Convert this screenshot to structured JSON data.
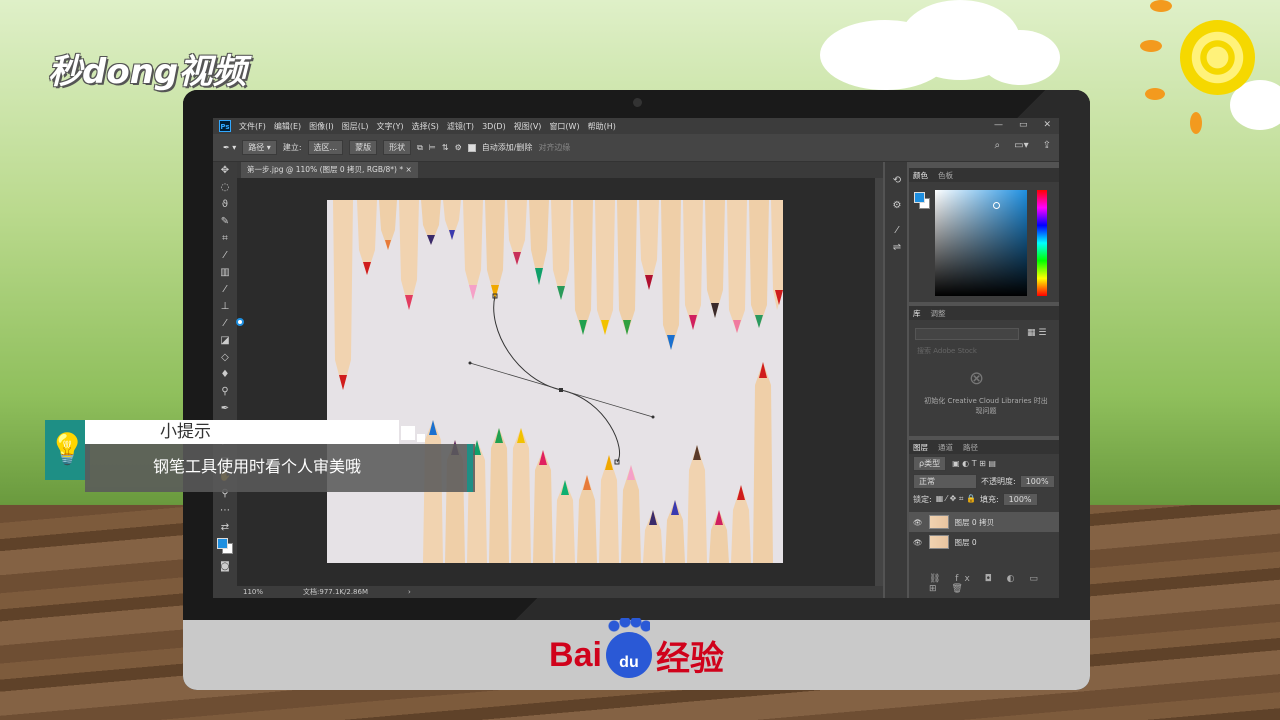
{
  "watermark": {
    "logo_text": "秒dong视频"
  },
  "photoshop": {
    "app_icon": "Ps",
    "menu": [
      "文件(F)",
      "编辑(E)",
      "图像(I)",
      "图层(L)",
      "文字(Y)",
      "选择(S)",
      "滤镜(T)",
      "3D(D)",
      "视图(V)",
      "窗口(W)",
      "帮助(H)"
    ],
    "window_controls": [
      "—",
      "▭",
      "✕"
    ],
    "options": {
      "mode_value": "路径",
      "make_label": "建立:",
      "selection_btn": "选区...",
      "mask_btn": "蒙版",
      "shape_btn": "形状",
      "auto_add_delete": "自动添加/删除",
      "align_edges": "对齐边缘"
    },
    "document_tab": "第一步.jpg @ 110% (图层 0 拷贝, RGB/8*) *",
    "document_tab_close": "×",
    "status": {
      "zoom": "110%",
      "doc_size": "文档:977.1K/2.86M",
      "arrow": "›"
    },
    "color_panel": {
      "tabs": [
        "颜色",
        "色板"
      ],
      "fg_color": "#1e8fe0"
    },
    "libraries_panel": {
      "tabs": [
        "库",
        "调整"
      ],
      "search_placeholder": "搜索 Adobe Stock",
      "message": "初始化 Creative Cloud Libraries 时出现问题"
    },
    "layers_panel": {
      "tabs": [
        "图层",
        "通道",
        "路径"
      ],
      "filter_label": "ρ类型",
      "blend_mode": "正常",
      "opacity_label": "不透明度:",
      "opacity_value": "100%",
      "lock_label": "锁定:",
      "fill_label": "填充:",
      "fill_value": "100%",
      "layers": [
        {
          "name": "图层 0 拷贝",
          "eye": "👁"
        },
        {
          "name": "图层 0",
          "eye": "👁"
        }
      ]
    }
  },
  "tip": {
    "icon": "💡",
    "title": "小提示",
    "body": "钢笔工具使用时看个人审美哦"
  },
  "brand": {
    "baidu_left": "Bai",
    "baidu_paw_text": "du",
    "baidu_right": "经验"
  },
  "colors": {
    "teal": "#1e8f85",
    "baidu_red": "#d0021b",
    "baidu_blue": "#2a59d6"
  }
}
